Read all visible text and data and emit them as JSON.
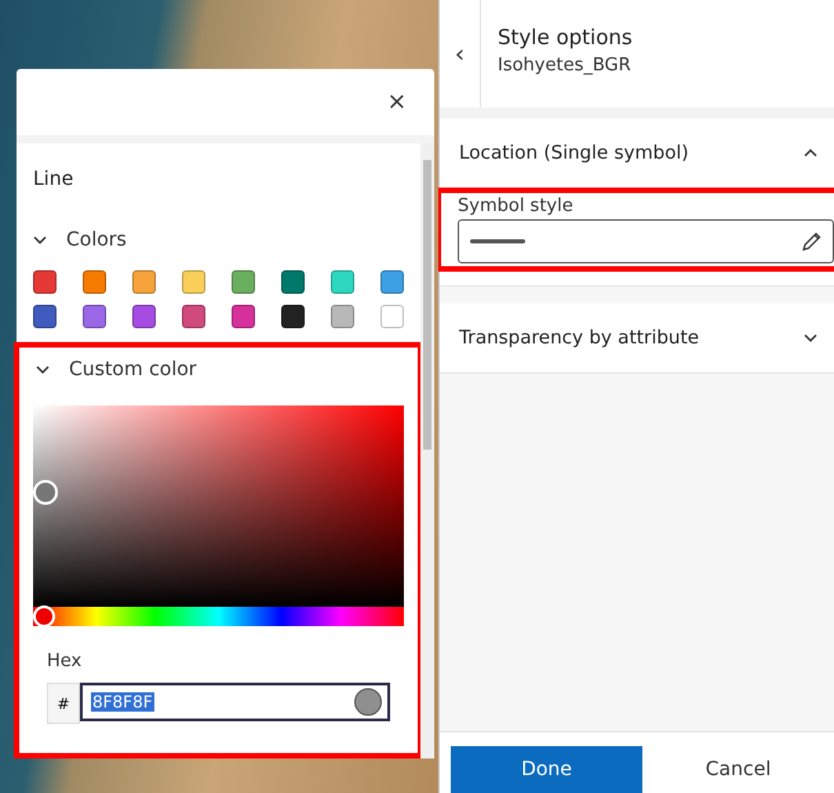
{
  "popup": {
    "section_title": "Line",
    "colors": {
      "label": "Colors",
      "expanded": true,
      "swatches": [
        {
          "color": "#e53935"
        },
        {
          "color": "#f57c00"
        },
        {
          "color": "#f5a33a"
        },
        {
          "color": "#f9cf5a"
        },
        {
          "color": "#6aaf5f"
        },
        {
          "color": "#00796b"
        },
        {
          "color": "#2ed8c0"
        },
        {
          "color": "#3ea0e4"
        },
        {
          "color": "#3f5bbd"
        },
        {
          "color": "#9a67e6"
        },
        {
          "color": "#a64ce0"
        },
        {
          "color": "#d04a7e"
        },
        {
          "color": "#d6309a"
        },
        {
          "color": "#222222"
        },
        {
          "color": "#b8b8b8"
        },
        {
          "color": "#ffffff"
        }
      ]
    },
    "custom_color": {
      "label": "Custom color",
      "expanded": true,
      "highlighted": true,
      "hue": {
        "level": 0
      },
      "hex_label": "Hex",
      "hash": "#",
      "hex_value": "8F8F8F"
    },
    "close": "×"
  },
  "panel": {
    "back": "‹",
    "title": "Style options",
    "subtitle": "Isohyetes_BGR",
    "sections": [
      {
        "label": "Location (Single symbol)",
        "expanded": true,
        "field": {
          "label": "Symbol style",
          "highlighted": true
        }
      },
      {
        "label": "Transparency by attribute",
        "expanded": false
      }
    ],
    "buttons": [
      {
        "label": "Done",
        "kind": "primary"
      },
      {
        "label": "Cancel",
        "kind": "secondary"
      }
    ]
  }
}
